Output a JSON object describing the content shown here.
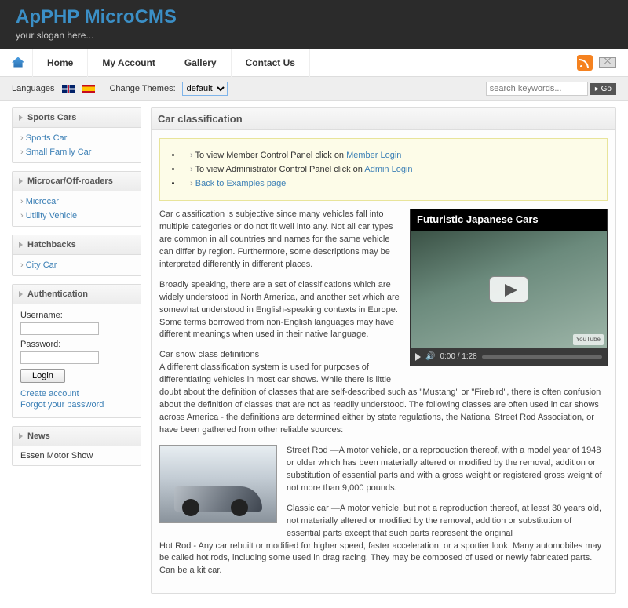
{
  "header": {
    "title": "ApPHP MicroCMS",
    "slogan": "your slogan here..."
  },
  "nav": {
    "items": [
      "Home",
      "My Account",
      "Gallery",
      "Contact Us"
    ]
  },
  "toolbar": {
    "languages_label": "Languages",
    "change_themes_label": "Change Themes:",
    "theme_selected": "default",
    "search_placeholder": "search keywords...",
    "go_label": "Go"
  },
  "sidebar": {
    "boxes": [
      {
        "title": "Sports Cars",
        "items": [
          "Sports Car",
          "Small Family Car"
        ]
      },
      {
        "title": "Microcar/Off-roaders",
        "items": [
          "Microcar",
          "Utility Vehicle"
        ]
      },
      {
        "title": "Hatchbacks",
        "items": [
          "City Car"
        ]
      }
    ],
    "auth": {
      "title": "Authentication",
      "username_label": "Username:",
      "password_label": "Password:",
      "login_label": "Login",
      "create_label": "Create account",
      "forgot_label": "Forgot your password"
    },
    "news": {
      "title": "News",
      "item0": "Essen Motor Show"
    }
  },
  "main": {
    "title": "Car classification",
    "notice": {
      "line1_pre": "To view Member Control Panel click on ",
      "line1_link": "Member Login",
      "line2_pre": "To view Administrator Control Panel click on ",
      "line2_link": "Admin Login",
      "line3_link": "Back to Examples page"
    },
    "video": {
      "title": "Futuristic Japanese Cars",
      "time": "0:00 / 1:28",
      "yt": "YouTube"
    },
    "p1": "Car classification is subjective since many vehicles fall into multiple categories or do not fit well into any. Not all car types are common in all countries and names for the same vehicle can differ by region. Furthermore, some descriptions may be interpreted differently in different places.",
    "p2": "Broadly speaking, there are a set of classifications which are widely understood in North America, and another set which are somewhat understood in English-speaking contexts in Europe. Some terms borrowed from non-English languages may have different meanings when used in their native language.",
    "p3": "Car show class definitions\nA different classification system is used for purposes of differentiating vehicles in most car shows. While there is little doubt about the definition of classes that are self-described such as \"Mustang\" or \"Firebird\", there is often confusion about the definition of classes that are not as readily understood. The following classes are often used in car shows across America - the definitions are determined either by state regulations, the National Street Rod Association, or have been gathered from other reliable sources:",
    "p4": "Street Rod —A motor vehicle, or a reproduction thereof, with a model year of 1948 or older which has been materially altered or modified by the removal, addition or substitution of essential parts and with a gross weight or registered gross weight of not more than 9,000 pounds.",
    "p5": "Classic car —A motor vehicle, but not a reproduction thereof, at least 30 years old, not materially altered or modified by the removal, addition or substitution of essential parts except that such parts represent the original\nHot Rod - Any car rebuilt or modified for higher speed, faster acceleration, or a sportier look. Many automobiles may be called hot rods, including some used in drag racing. They may be composed of used or newly fabricated parts. Can be a kit car."
  }
}
